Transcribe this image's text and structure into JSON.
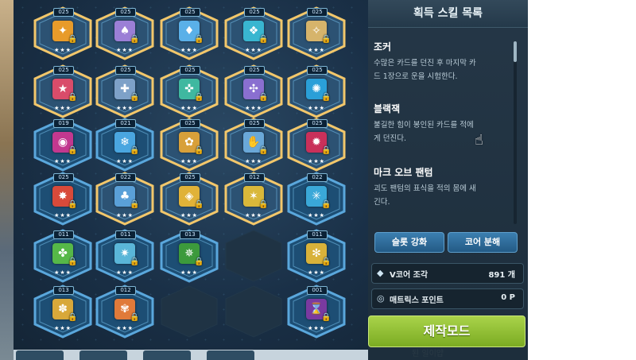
{
  "skill_panel": {
    "title": "획득 스킬 목록",
    "skills": [
      {
        "name": "조커",
        "desc_line1": "수많은 카드를 던진 후 마지막 카",
        "desc_line2": "드 1장으로 운을 시험한다."
      },
      {
        "name": "블랙잭",
        "desc_line1": "불길한 힘이 봉인된 카드를 적에",
        "desc_line2": "게 던진다."
      },
      {
        "name": "마크 오브 팬텀",
        "desc_line1": "괴도 팬텀의 표식을 적의 몸에 새",
        "desc_line2": "긴다."
      }
    ]
  },
  "buttons": {
    "slot_upgrade": "슬롯 강화",
    "core_disassemble": "코어 분해",
    "craft_mode": "제작모드"
  },
  "stats": {
    "vcore_label": "V코어 조각",
    "vcore_value": "891 개",
    "matrix_label": "매트릭스 포인트",
    "matrix_value": "0  P"
  },
  "bottom_peek": "된 일이얍",
  "grid": {
    "level_labels": {
      "r1": [
        "025",
        "025",
        "025",
        "025",
        "025"
      ],
      "r2": [
        "025",
        "025",
        "025",
        "025",
        "025"
      ],
      "r3": [
        "019",
        "021",
        "025",
        "025",
        "025"
      ],
      "r4": [
        "025",
        "022",
        "025",
        "012",
        "022"
      ],
      "r5": [
        "011",
        "011",
        "013",
        "",
        "011"
      ],
      "r6": [
        "013",
        "012",
        "",
        "",
        "001"
      ]
    }
  },
  "colors": {
    "accent_green": "#8bc43a",
    "hex_border": "#f2c76b",
    "hex_blue": "#3c86bf"
  }
}
